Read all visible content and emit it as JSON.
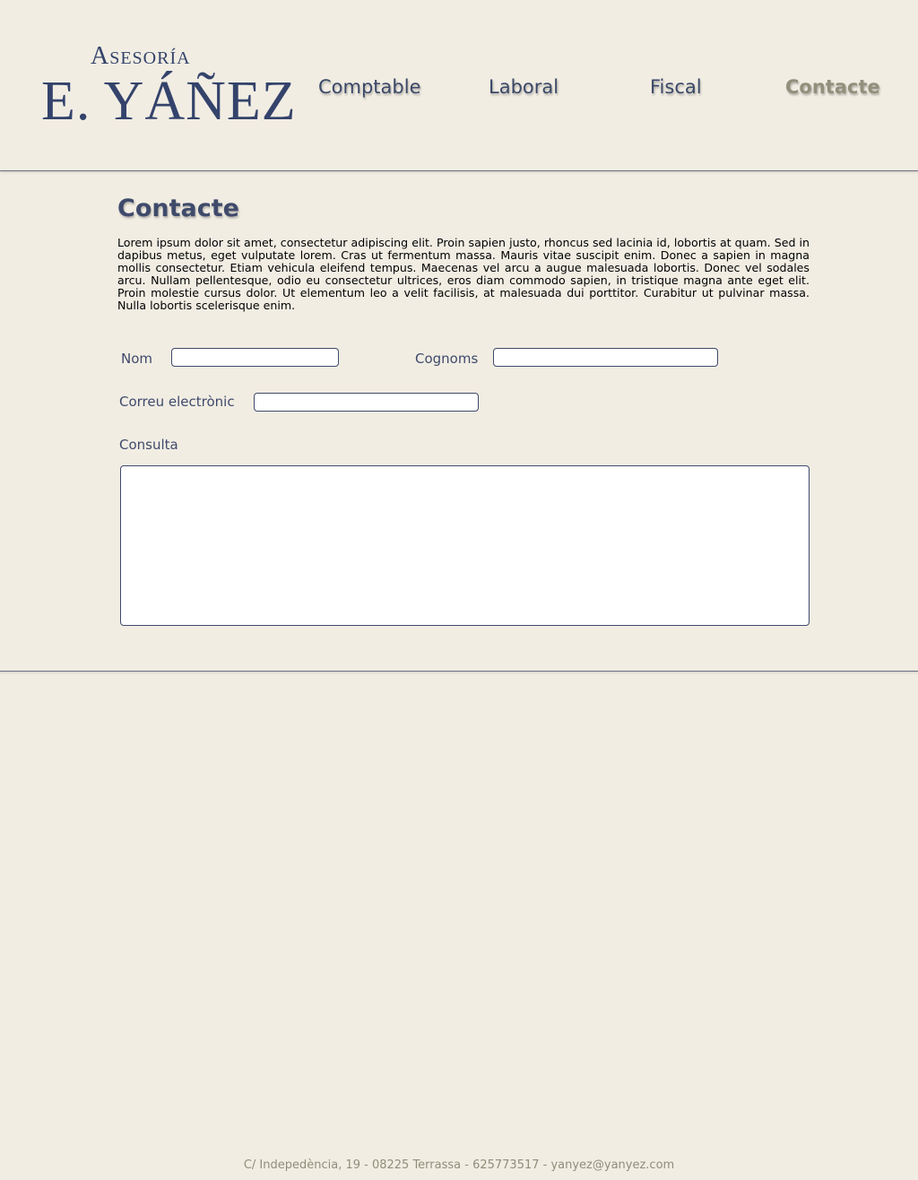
{
  "brand": {
    "line1": "Asesoría",
    "line2": "E. YÁÑEZ"
  },
  "nav": {
    "items": [
      {
        "label": "Comptable",
        "active": false
      },
      {
        "label": "Laboral",
        "active": false
      },
      {
        "label": "Fiscal",
        "active": false
      },
      {
        "label": "Contacte",
        "active": true
      }
    ]
  },
  "main": {
    "title": "Contacte",
    "intro": "Lorem ipsum dolor sit amet, consectetur adipiscing elit. Proin sapien justo, rhoncus sed lacinia id, lobortis at quam. Sed in dapibus metus, eget vulputate lorem. Cras ut fermentum massa. Mauris vitae suscipit enim. Donec a sapien in magna mollis consectetur. Etiam vehicula eleifend tempus. Maecenas vel arcu a augue malesuada lobortis. Donec vel sodales arcu. Nullam pellentesque, odio eu consectetur ultrices, eros diam commodo sapien, in tristique magna ante eget elit. Proin molestie cursus dolor. Ut elementum leo a velit facilisis, at malesuada dui porttitor. Curabitur ut pulvinar massa. Nulla lobortis scelerisque enim."
  },
  "form": {
    "nom_label": "Nom",
    "nom_value": "",
    "cognoms_label": "Cognoms",
    "cognoms_value": "",
    "email_label": "Correu electrònic",
    "email_value": "",
    "consulta_label": "Consulta",
    "consulta_value": ""
  },
  "footer": {
    "text": "C/ Indepedència, 19 - 08225 Terrassa - 625773517 -  yanyez@yanyez.com"
  },
  "colors": {
    "background": "#f1ede3",
    "brand_navy": "#34436b",
    "nav_active": "#928f7c"
  }
}
